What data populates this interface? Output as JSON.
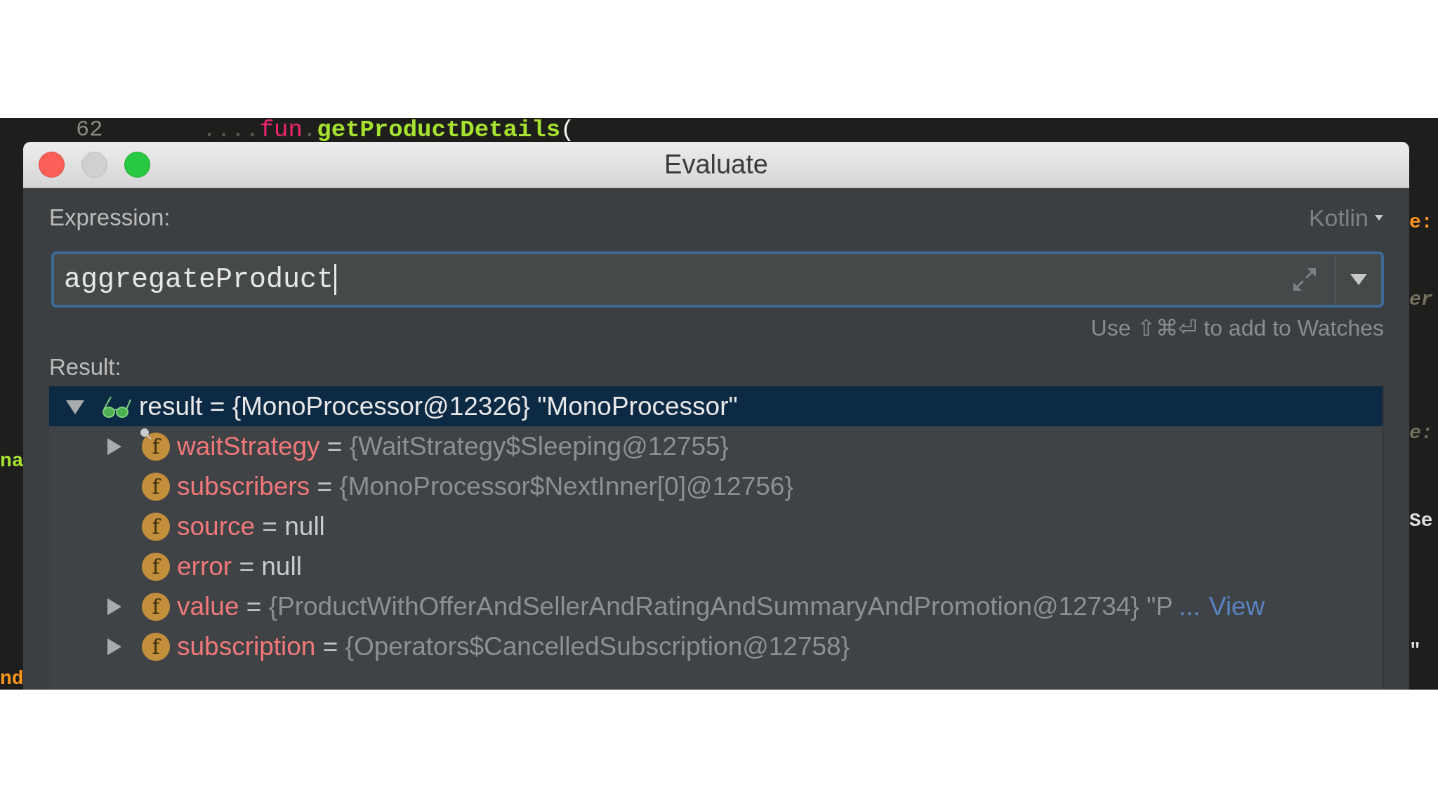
{
  "editor": {
    "line_number": "62",
    "code": [
      {
        "text": "....",
        "kind": "whitespace"
      },
      {
        "text": "fun",
        "kind": "keyword"
      },
      {
        "text": ".",
        "kind": "whitespace"
      },
      {
        "text": "getProductDetails",
        "kind": "function"
      },
      {
        "text": "(",
        "kind": "punct"
      }
    ],
    "left_fragments": [
      {
        "text": "na",
        "kind": "function"
      },
      {
        "text": "nd",
        "kind": "property"
      }
    ],
    "right_fragments": [
      {
        "text": "e:",
        "kind": "property"
      },
      {
        "text": "er",
        "kind": "comment"
      },
      {
        "text": "e:",
        "kind": "comment"
      },
      {
        "text": "Se",
        "kind": "plain"
      },
      {
        "text": "\"",
        "kind": "plain"
      }
    ]
  },
  "window": {
    "title": "Evaluate",
    "traffic_lights": [
      {
        "kind": "close",
        "enabled": true
      },
      {
        "kind": "minimize",
        "enabled": false
      },
      {
        "kind": "zoom",
        "enabled": true
      }
    ]
  },
  "expression": {
    "label": "Expression:",
    "language": "Kotlin",
    "value": "aggregateProduct",
    "hint": "Use ⇧⌘⏎ to add to Watches"
  },
  "result": {
    "label": "Result:",
    "tree": [
      {
        "name": "result",
        "operator": "=",
        "value": "{MonoProcessor@12326} \"MonoProcessor\"",
        "kind": "object",
        "expandable": true,
        "expanded": true,
        "selected": true,
        "children": [
          {
            "name": "waitStrategy",
            "badge": "f",
            "operator": "=",
            "value": "{WaitStrategy$Sleeping@12755}",
            "kind": "object",
            "expandable": true,
            "expanded": false,
            "pinned": true,
            "selected": false
          },
          {
            "name": "subscribers",
            "badge": "f",
            "operator": "=",
            "value": "{MonoProcessor$NextInner[0]@12756}",
            "kind": "object",
            "expandable": false,
            "pinned": false,
            "selected": false
          },
          {
            "name": "source",
            "badge": "f",
            "operator": "=",
            "value": "null",
            "kind": "null",
            "expandable": false,
            "pinned": false,
            "selected": false
          },
          {
            "name": "error",
            "badge": "f",
            "operator": "=",
            "value": "null",
            "kind": "null",
            "expandable": false,
            "pinned": false,
            "selected": false
          },
          {
            "name": "value",
            "badge": "f",
            "operator": "=",
            "value": "{ProductWithOfferAndSellerAndRatingAndSummaryAndPromotion@12734} \"P",
            "kind": "object",
            "truncation": "...",
            "link": "View",
            "expandable": true,
            "expanded": false,
            "pinned": false,
            "selected": false
          },
          {
            "name": "subscription",
            "badge": "f",
            "operator": "=",
            "value": "{Operators$CancelledSubscription@12758}",
            "kind": "object",
            "expandable": true,
            "expanded": false,
            "pinned": false,
            "selected": false
          }
        ]
      }
    ]
  }
}
